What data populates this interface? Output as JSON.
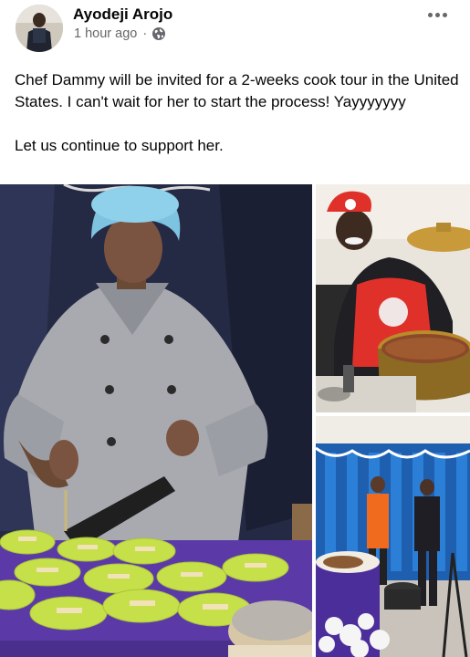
{
  "post": {
    "author": "Ayodeji Arojo",
    "timestamp": "1 hour ago",
    "separator": "·",
    "privacy_icon": "globe-icon",
    "more_icon": "more-options-icon",
    "text": {
      "paragraph1": "Chef Dammy will be invited for a 2-weeks cook tour in the United States. I can't wait for her to start the process! Yayyyyyyy",
      "paragraph2": "Let us continue to support her."
    }
  },
  "photos": [
    {
      "subject": "chef-serving-food"
    },
    {
      "subject": "chef-with-cooking-pot"
    },
    {
      "subject": "cooking-event-hall"
    }
  ],
  "colors": {
    "name": "#050505",
    "meta": "#65676b",
    "plate_green": "#c6e04a",
    "tablecloth_purple": "#5b3aa8",
    "hairnet_blue": "#7ec3e0",
    "apron_red": "#e0302a"
  }
}
